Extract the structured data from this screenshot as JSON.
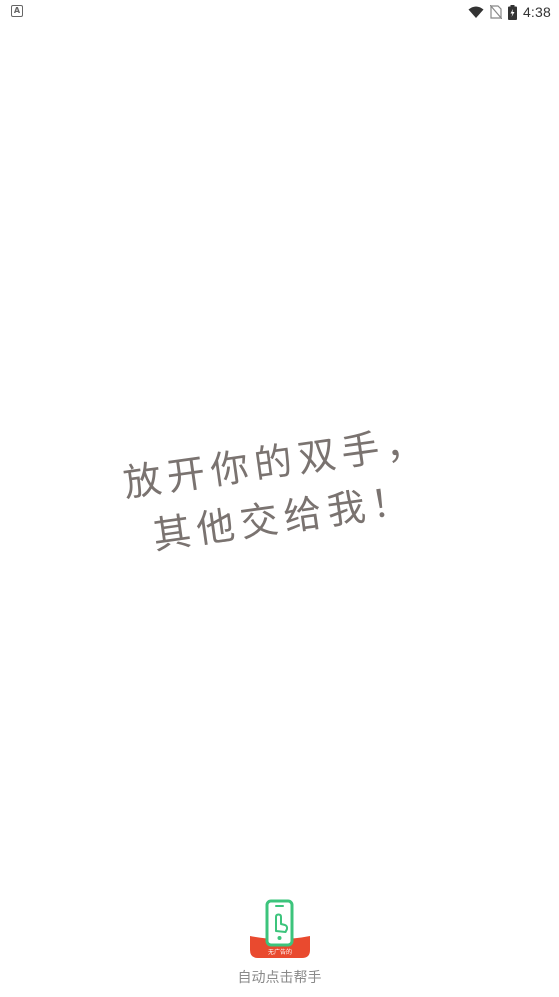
{
  "status_bar": {
    "notification_icon": "A",
    "time": "4:38",
    "icons": [
      "wifi-icon",
      "no-sim-icon",
      "battery-charging-icon"
    ]
  },
  "slogan": {
    "line1": "放开你的双手，",
    "line2": "其他交给我！"
  },
  "app": {
    "badge_text": "无广告的",
    "name": "自动点击帮手"
  },
  "colors": {
    "slogan": "#7a7370",
    "icon_green": "#3cc47c",
    "icon_red": "#e94a2f",
    "app_name": "#8a8a8a"
  }
}
